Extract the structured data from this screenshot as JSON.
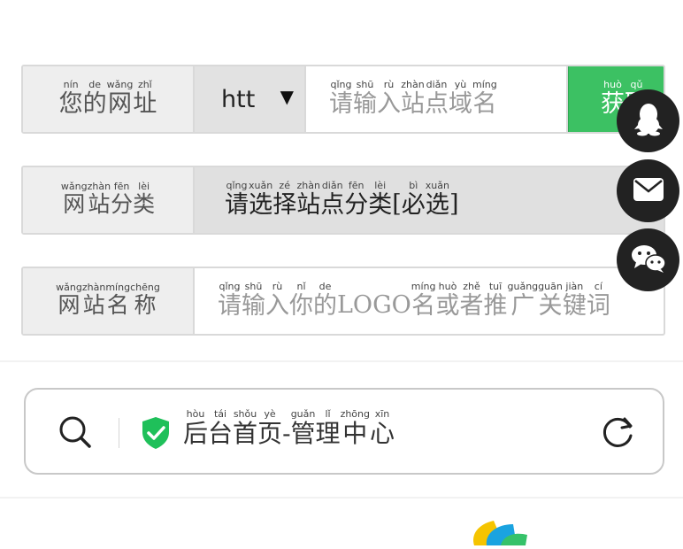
{
  "form": {
    "url_row": {
      "label": [
        "您",
        "的",
        "网",
        "址"
      ],
      "label_pinyin": [
        "nín",
        "de",
        "wǎng",
        "zhǐ"
      ],
      "protocol_value": "htt",
      "protocol_caret": "▼",
      "placeholder": [
        "请",
        "输",
        "入",
        "站",
        "点",
        "域",
        "名"
      ],
      "placeholder_pinyin": [
        "qǐng",
        "shū",
        "rù",
        "zhàn",
        "diǎn",
        "yù",
        "míng"
      ],
      "fetch_button": [
        "获",
        "取"
      ],
      "fetch_button_pinyin": [
        "huò",
        "qǔ"
      ]
    },
    "category_row": {
      "label": [
        "网",
        "站",
        "分",
        "类"
      ],
      "label_pinyin": [
        "wǎng",
        "zhàn",
        "fēn",
        "lèi"
      ],
      "select_value": [
        "请",
        "选",
        "择",
        "站",
        "点",
        "分",
        "类",
        "[",
        "必",
        "选",
        "]"
      ],
      "select_value_pinyin": [
        "qǐng",
        "xuǎn",
        "zé",
        "zhàn",
        "diǎn",
        "fēn",
        "lèi",
        "",
        "bì",
        "xuǎn",
        ""
      ]
    },
    "name_row": {
      "label": [
        "网",
        "站",
        "名",
        "称"
      ],
      "label_pinyin": [
        "wǎng",
        "zhàn",
        "míng",
        "chēng"
      ],
      "placeholder": [
        "请",
        "输",
        "入",
        "你",
        "的",
        "LOGO",
        "名",
        "或",
        "者",
        "推",
        "广",
        "关",
        "键",
        "词"
      ],
      "placeholder_pinyin": [
        "qǐng",
        "shū",
        "rù",
        "nǐ",
        "de",
        "",
        "míng",
        "huò",
        "zhě",
        "tuī",
        "guǎng",
        "guān",
        "jiàn",
        "cí"
      ]
    }
  },
  "browser_bar": {
    "address": [
      "后",
      "台",
      "首",
      "页",
      "-",
      "管",
      "理",
      "中",
      "心"
    ],
    "address_pinyin": [
      "hòu",
      "tái",
      "shǒu",
      "yè",
      "",
      "guǎn",
      "lǐ",
      "zhōng",
      "xīn"
    ],
    "secure_color": "#1fc05a"
  },
  "floating_buttons": {
    "icons": [
      "qq-penguin-icon",
      "mail-icon",
      "wechat-icon"
    ],
    "background": "#222222"
  },
  "colors": {
    "accent_green": "#3cc163",
    "label_bg": "#eeeeee",
    "border": "#d9d9d9"
  }
}
